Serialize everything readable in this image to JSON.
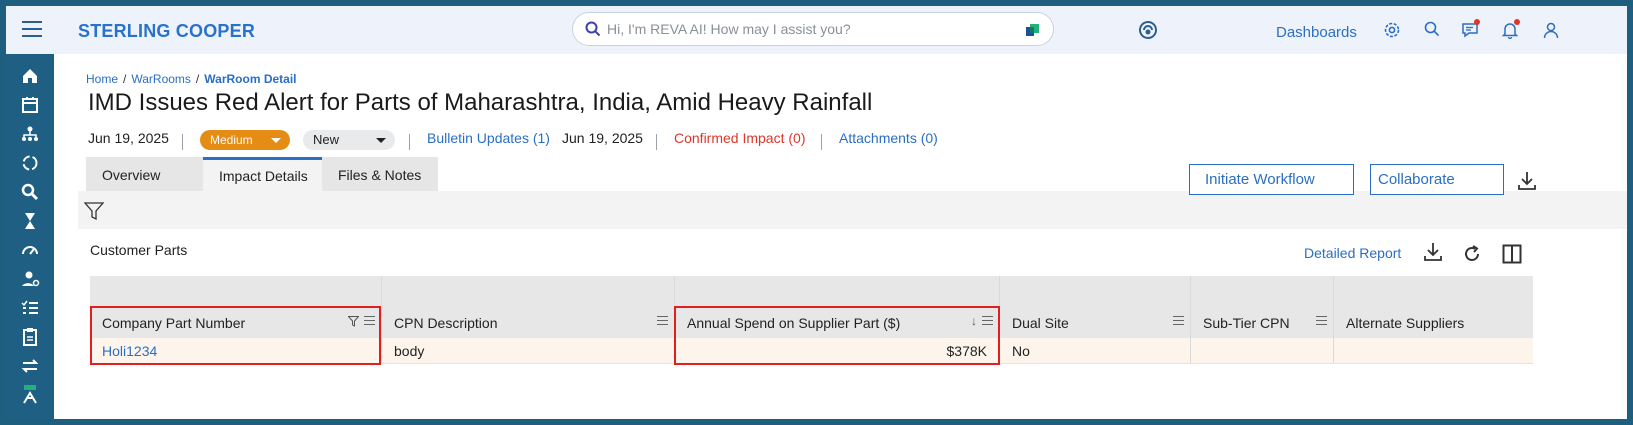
{
  "header": {
    "brand": "STERLING COOPER",
    "search_placeholder": "Hi, I'm REVA AI! How may I assist you?",
    "dashboards_label": "Dashboards"
  },
  "breadcrumb": {
    "home": "Home",
    "warrooms": "WarRooms",
    "current": "WarRoom Detail"
  },
  "page": {
    "title": "IMD Issues Red Alert for Parts of Maharashtra, India, Amid Heavy Rainfall",
    "date": "Jun 19, 2025",
    "severity": "Medium",
    "status": "New",
    "bulletin_updates": "Bulletin Updates (1)",
    "bulletin_date": "Jun 19, 2025",
    "confirmed_impact": "Confirmed Impact (0)",
    "attachments": "Attachments (0)"
  },
  "tabs": [
    {
      "label": "Overview",
      "active": false
    },
    {
      "label": "Impact Details",
      "active": true
    },
    {
      "label": "Files & Notes",
      "active": false
    }
  ],
  "actions": {
    "initiate_workflow": "Initiate Workflow",
    "collaborate": "Collaborate"
  },
  "card": {
    "title": "Customer Parts",
    "detailed_report": "Detailed Report"
  },
  "table": {
    "columns": [
      "Company Part Number",
      "CPN Description",
      "Annual Spend on Supplier Part ($)",
      "Dual Site",
      "Sub-Tier CPN",
      "Alternate Suppliers"
    ],
    "rows": [
      {
        "company_part_number": "Holi1234",
        "cpn_description": "body",
        "annual_spend": "$378K",
        "dual_site": "No",
        "sub_tier_cpn": "",
        "alternate_suppliers": ""
      }
    ]
  },
  "colors": {
    "brand_blue": "#2a72c9",
    "sidebar": "#1f5f84",
    "severity_medium": "#e58c14",
    "alert_red": "#e0352b"
  }
}
